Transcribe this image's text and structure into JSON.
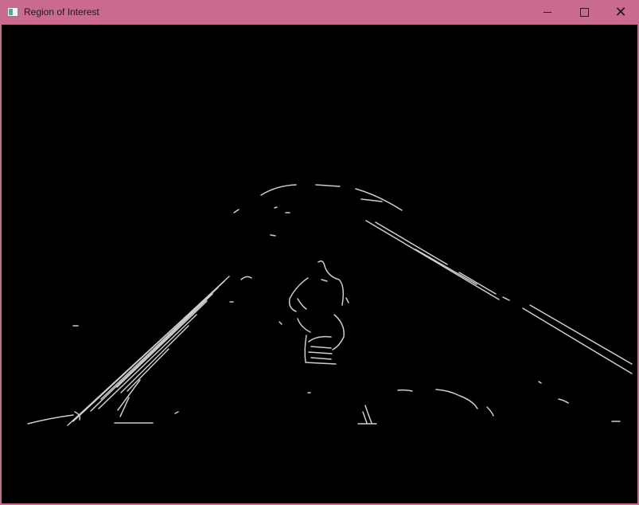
{
  "window": {
    "title": "Region of Interest",
    "icon": "opencv-window-icon",
    "controls": {
      "minimize": "minimize-icon",
      "maximize": "maximize-icon",
      "close": "close-icon",
      "close_glyph": "✕"
    },
    "title_bar_color": "#c96a8e",
    "canvas_color": "#000000"
  },
  "image": {
    "description_type": "edge-detected road region of interest",
    "edge_color": "#d6d6d6"
  }
}
